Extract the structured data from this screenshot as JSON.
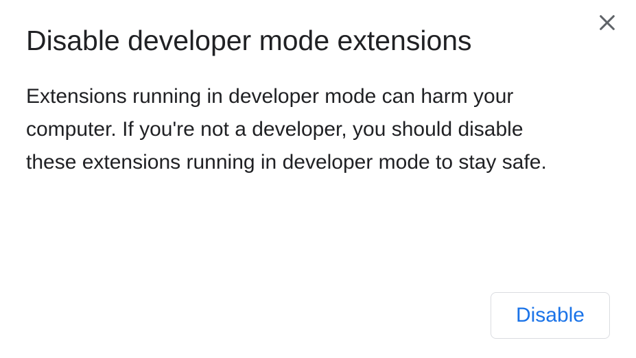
{
  "dialog": {
    "title": "Disable developer mode extensions",
    "body": "Extensions running in developer mode can harm your computer. If you're not a developer, you should disable these extensions running in developer mode to stay safe.",
    "actions": {
      "disable_label": "Disable"
    }
  }
}
